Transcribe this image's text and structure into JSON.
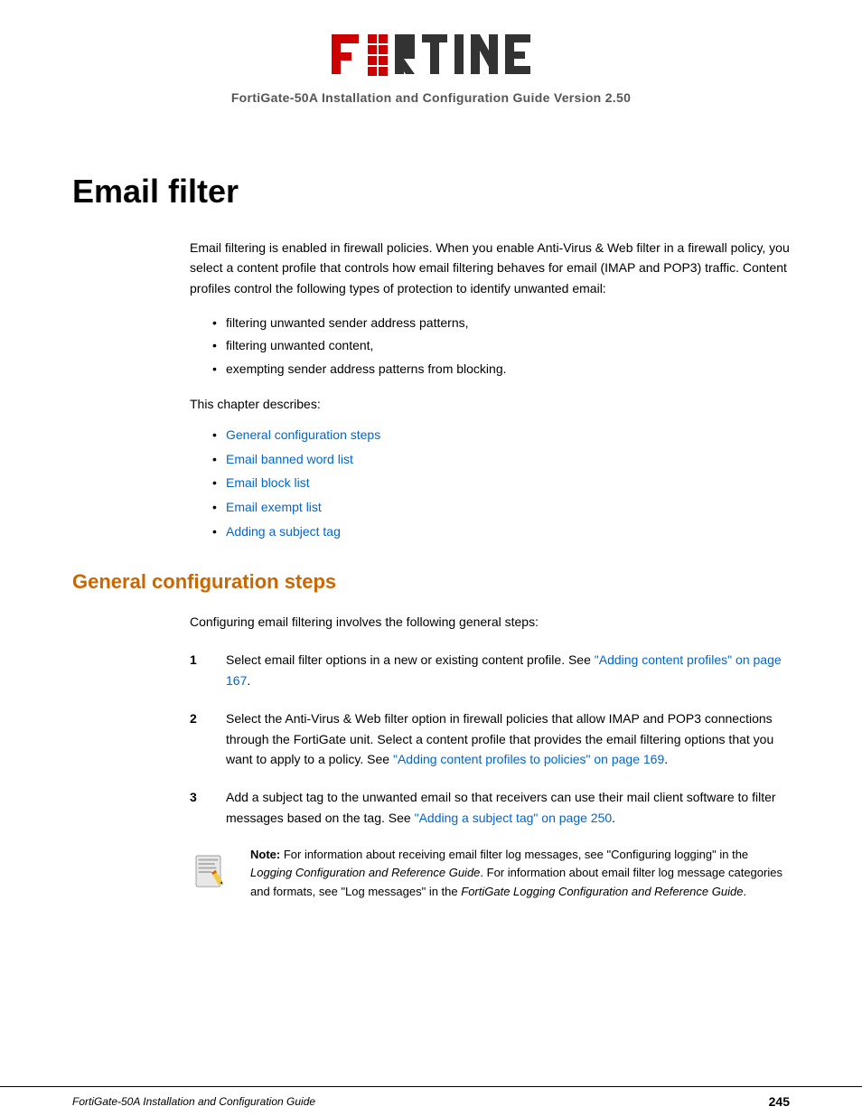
{
  "header": {
    "subtitle": "FortiGate-50A Installation and Configuration Guide Version 2.50"
  },
  "page": {
    "title": "Email filter",
    "intro_paragraph": "Email filtering is enabled in firewall policies. When you enable Anti-Virus & Web filter in a firewall policy, you select a content profile that controls how email filtering behaves for email (IMAP and POP3) traffic. Content profiles control the following types of protection to identify unwanted email:",
    "bullet_items": [
      "filtering unwanted sender address patterns,",
      "filtering unwanted content,",
      "exempting sender address patterns from blocking."
    ],
    "chapter_intro": "This chapter describes:",
    "chapter_links": [
      "General configuration steps",
      "Email banned word list",
      "Email block list",
      "Email exempt list",
      "Adding a subject tag"
    ],
    "section_heading": "General configuration steps",
    "step_intro": "Configuring email filtering involves the following general steps:",
    "steps": [
      {
        "number": "1",
        "text_before": "Select email filter options in a new or existing content profile. See ",
        "link_text": "\"Adding content profiles\" on page 167",
        "text_after": "."
      },
      {
        "number": "2",
        "text_before": "Select the Anti-Virus & Web filter option in firewall policies that allow IMAP and POP3 connections through the FortiGate unit. Select a content profile that provides the email filtering options that you want to apply to a policy. See ",
        "link_text": "\"Adding content profiles to policies\" on page 169",
        "text_after": "."
      },
      {
        "number": "3",
        "text_before": "Add a subject tag to the unwanted email so that receivers can use their mail client software to filter messages based on the tag. See ",
        "link_text": "\"Adding a subject tag\" on page 250",
        "text_after": "."
      }
    ],
    "note_bold": "Note:",
    "note_text": " For information about receiving email filter log messages, see \"Configuring logging\" in the ",
    "note_italic1": "Logging Configuration and Reference Guide",
    "note_text2": ". For information about email filter log message categories and formats, see \"Log messages\" in the ",
    "note_italic2": "FortiGate Logging Configuration and Reference Guide",
    "note_text3": "."
  },
  "footer": {
    "left_text": "FortiGate-50A Installation and Configuration Guide",
    "page_number": "245"
  }
}
